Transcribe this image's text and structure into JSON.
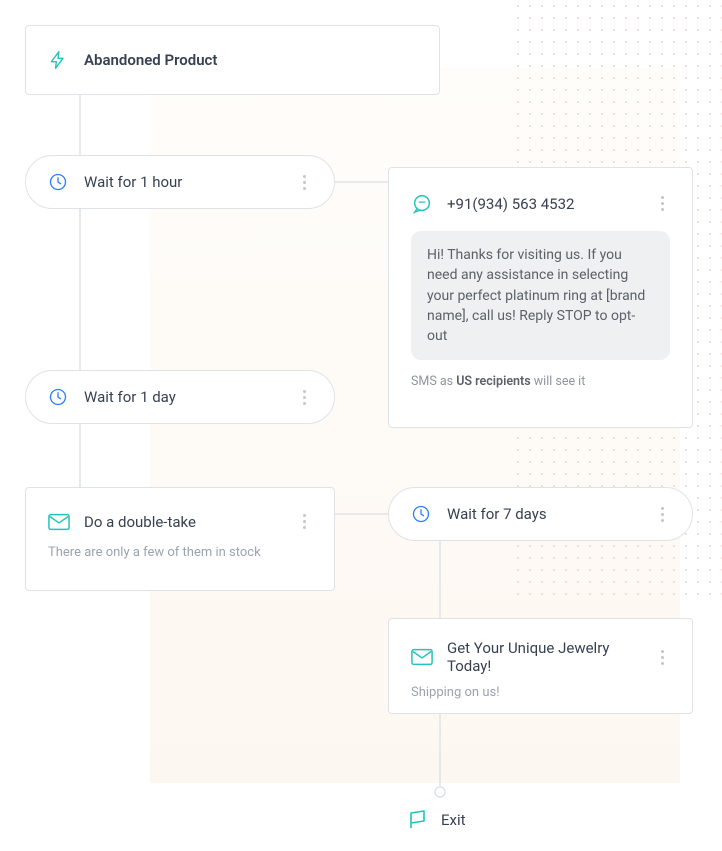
{
  "trigger": {
    "label": "Abandoned Product"
  },
  "wait1": {
    "label": "Wait for 1 hour"
  },
  "wait2": {
    "label": "Wait for 1 day"
  },
  "wait3": {
    "label": "Wait for 7 days"
  },
  "preview": {
    "phone": "+91(934) 563 4532",
    "bubble": "Hi! Thanks for visiting us. If you need any assistance in selecting your perfect platinum ring at [brand name], call us! Reply STOP to opt-out",
    "caption_lead": "SMS as ",
    "caption_bold": "US recipients",
    "caption_tail": " will see it"
  },
  "email1": {
    "title": "Do a double-take",
    "sub": "There are only a few of them in stock"
  },
  "email2": {
    "title": "Get Your Unique Jewelry Today!",
    "sub": "Shipping on us!"
  },
  "exit": {
    "label": "Exit"
  }
}
